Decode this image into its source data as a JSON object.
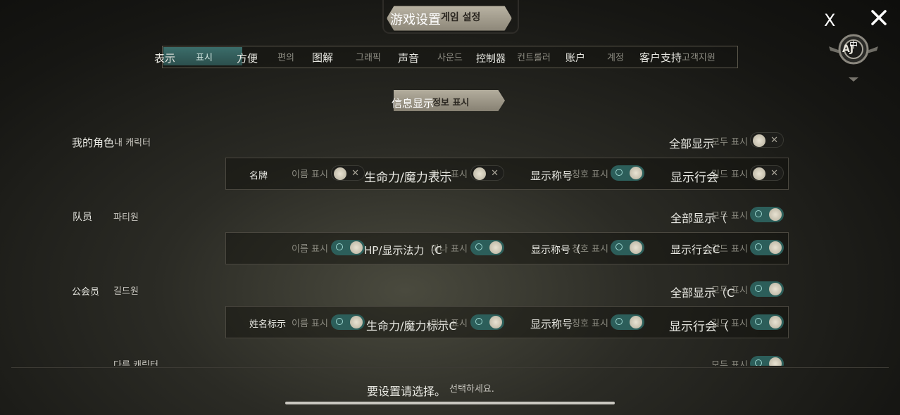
{
  "title": {
    "label_cn": "游戏设置",
    "label_kr": "게임 설정"
  },
  "close": {
    "label": "X",
    "icon": "close-icon"
  },
  "emblem": {
    "text": "AJ",
    "accent": "中"
  },
  "tabs": [
    {
      "label": "表示",
      "label_kr": "표시",
      "active": true
    },
    {
      "label": "方便",
      "label_kr": "편의"
    },
    {
      "label": "图解",
      "label_kr": "그래픽"
    },
    {
      "label": "声音",
      "label_kr": "사운드"
    },
    {
      "label": "控制器",
      "label_kr": "컨트롤러"
    },
    {
      "label": "账户",
      "label_kr": "계정"
    },
    {
      "label": "客户支持",
      "label_kr": "고객지원"
    }
  ],
  "section": {
    "label_cn": "信息显示",
    "label_kr": "정보 표시"
  },
  "groups": [
    {
      "label_cn": "我的角色",
      "label_kr": "내 캐릭터",
      "show_all": {
        "label_cn": "全部显示",
        "label_kr": "모두 표시",
        "on": false
      },
      "row_label": "名牌",
      "items": [
        {
          "label_cn": "",
          "label_kr": "이름 표시",
          "on": false
        },
        {
          "label_cn": "生命力/魔力表示",
          "label_kr": "마나 표시",
          "on": false
        },
        {
          "label_cn": "显示称号",
          "label_kr": "칭호 표시",
          "on": true
        },
        {
          "label_cn": "显示行会",
          "label_kr": "길드 표시",
          "on": false
        }
      ]
    },
    {
      "label_cn": "队员",
      "label_kr": "파티원",
      "show_all": {
        "label_cn": "全部显示（",
        "label_kr": "모두 표시",
        "on": true
      },
      "row_label": "",
      "items": [
        {
          "label_cn": "",
          "label_kr": "이름 표시",
          "on": true
        },
        {
          "label_cn": "HP/显示法力（C",
          "label_kr": "마나 표시",
          "on": true
        },
        {
          "label_cn": "显示称号（",
          "label_kr": "칭호 표시",
          "on": true
        },
        {
          "label_cn": "显示行会C",
          "label_kr": "길드 표시",
          "on": true
        }
      ]
    },
    {
      "label_cn": "公会员",
      "label_kr": "길드원",
      "show_all": {
        "label_cn": "全部显示（C",
        "label_kr": "모두 표시",
        "on": true
      },
      "row_label": "姓名标示",
      "items": [
        {
          "label_cn": "",
          "label_kr": "이름 표시",
          "on": true
        },
        {
          "label_cn": "生命力/魔力标示C",
          "label_kr": "마나 표시",
          "on": true
        },
        {
          "label_cn": "显示称号",
          "label_kr": "칭호 표시",
          "on": true
        },
        {
          "label_cn": "显示行会（",
          "label_kr": "길드 표시",
          "on": true
        }
      ]
    },
    {
      "label_cn": "",
      "label_kr": "다른 캐릭터",
      "show_all": {
        "label_cn": "",
        "label_kr": "모두 표시",
        "on": true
      }
    }
  ],
  "footer": {
    "hint_cn": "要设置请选择。",
    "hint_kr": "선택하세요."
  },
  "colors": {
    "toggle_on": "#2c5e5a",
    "tab_active": "#3b6d6a",
    "plate": "#b3ad9d"
  }
}
